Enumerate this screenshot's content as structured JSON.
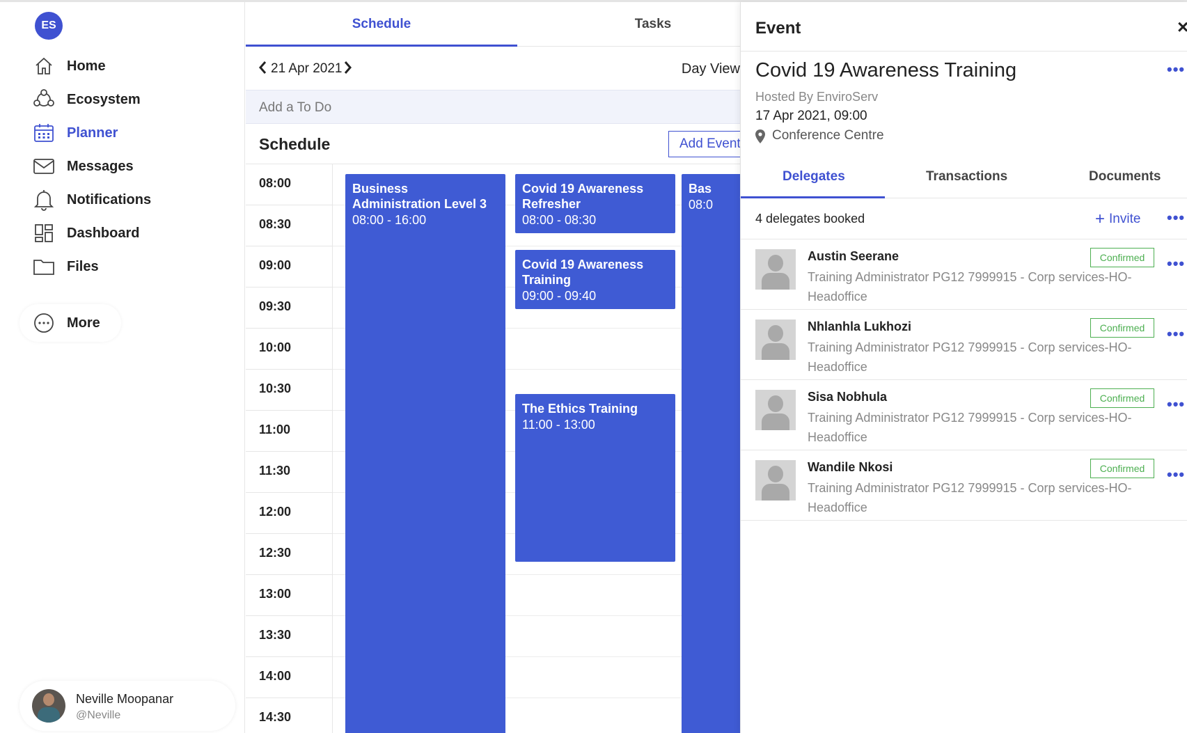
{
  "app": {
    "logo_text": "ES"
  },
  "sidebar": {
    "items": [
      {
        "label": "Home",
        "icon": "home-icon"
      },
      {
        "label": "Ecosystem",
        "icon": "ecosystem-icon"
      },
      {
        "label": "Planner",
        "icon": "calendar-icon",
        "active": true
      },
      {
        "label": "Messages",
        "icon": "mail-icon"
      },
      {
        "label": "Notifications",
        "icon": "bell-icon"
      },
      {
        "label": "Dashboard",
        "icon": "dashboard-icon"
      },
      {
        "label": "Files",
        "icon": "folder-icon"
      },
      {
        "label": "More",
        "icon": "more-icon"
      }
    ],
    "user": {
      "name": "Neville Moopanar",
      "handle": "@Neville"
    }
  },
  "schedule": {
    "tabs": [
      {
        "label": "Schedule",
        "active": true
      },
      {
        "label": "Tasks"
      }
    ],
    "date": "21 Apr 2021",
    "view": "Day View",
    "todo_placeholder": "Add a To Do",
    "title": "Schedule",
    "add_event_label": "Add Event",
    "times": [
      "08:00",
      "08:30",
      "09:00",
      "09:30",
      "10:00",
      "10:30",
      "11:00",
      "11:30",
      "12:00",
      "12:30",
      "13:00",
      "13:30",
      "14:00",
      "14:30"
    ],
    "events": [
      {
        "title": "Business Administration Level 3",
        "time": "08:00 - 16:00"
      },
      {
        "title": "Covid 19 Awareness Refresher",
        "time": "08:00 - 08:30"
      },
      {
        "title": "Covid 19 Awareness Training",
        "time": "09:00 - 09:40"
      },
      {
        "title": "The Ethics Training",
        "time": "11:00 - 13:00"
      },
      {
        "title": "Bas",
        "time": "08:0"
      }
    ]
  },
  "panel": {
    "title": "Event",
    "event_name": "Covid 19 Awareness Training",
    "hosted_by": "Hosted By EnviroServ",
    "datetime": "17 Apr 2021, 09:00",
    "location": "Conference Centre",
    "tabs": [
      {
        "label": "Delegates",
        "active": true
      },
      {
        "label": "Transactions"
      },
      {
        "label": "Documents"
      }
    ],
    "booked_text": "4 delegates booked",
    "invite_label": "Invite",
    "delegates": [
      {
        "name": "Austin Seerane",
        "role": "Training Administrator PG12 7999915 - Corp services-HO-Headoffice",
        "status": "Confirmed"
      },
      {
        "name": "Nhlanhla Lukhozi",
        "role": "Training Administrator PG12 7999915 - Corp services-HO-Headoffice",
        "status": "Confirmed"
      },
      {
        "name": "Sisa Nobhula",
        "role": "Training Administrator PG12 7999915 - Corp services-HO-Headoffice",
        "status": "Confirmed"
      },
      {
        "name": "Wandile Nkosi",
        "role": "Training Administrator PG12 7999915 - Corp services-HO-Headoffice",
        "status": "Confirmed"
      }
    ]
  },
  "colors": {
    "accent": "#3f51d1",
    "event_bg": "#3f5bd4",
    "confirmed": "#4caf50"
  }
}
